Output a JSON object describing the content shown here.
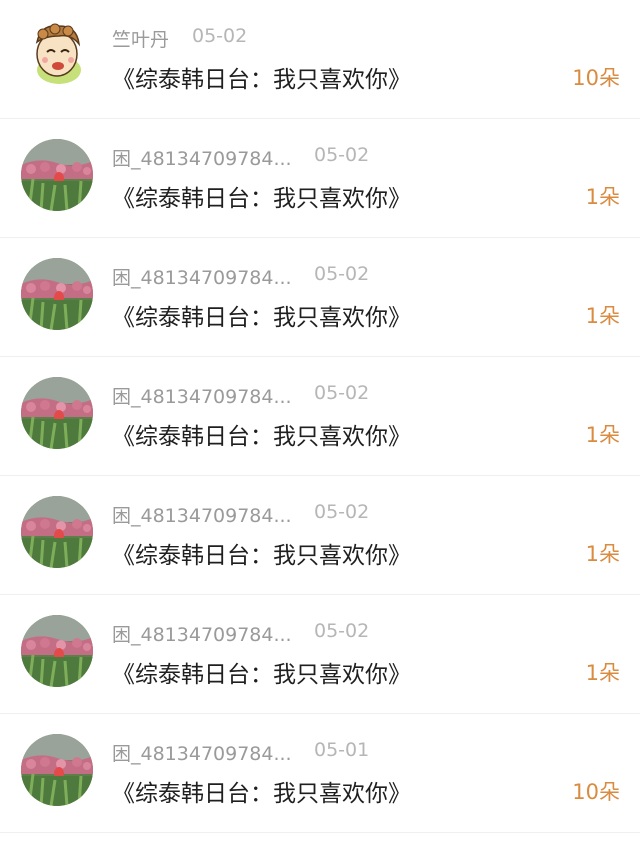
{
  "gifts": [
    {
      "name": "竺叶丹",
      "date": "05-02",
      "title": "《综泰韩日台：我只喜欢你》",
      "count": "10朵",
      "avatar": "cartoon-avatar"
    },
    {
      "name": "困_48134709784...",
      "date": "05-02",
      "title": "《综泰韩日台：我只喜欢你》",
      "count": "1朵",
      "avatar": "tulip-avatar"
    },
    {
      "name": "困_48134709784...",
      "date": "05-02",
      "title": "《综泰韩日台：我只喜欢你》",
      "count": "1朵",
      "avatar": "tulip-avatar"
    },
    {
      "name": "困_48134709784...",
      "date": "05-02",
      "title": "《综泰韩日台：我只喜欢你》",
      "count": "1朵",
      "avatar": "tulip-avatar"
    },
    {
      "name": "困_48134709784...",
      "date": "05-02",
      "title": "《综泰韩日台：我只喜欢你》",
      "count": "1朵",
      "avatar": "tulip-avatar"
    },
    {
      "name": "困_48134709784...",
      "date": "05-02",
      "title": "《综泰韩日台：我只喜欢你》",
      "count": "1朵",
      "avatar": "tulip-avatar"
    },
    {
      "name": "困_48134709784...",
      "date": "05-01",
      "title": "《综泰韩日台：我只喜欢你》",
      "count": "10朵",
      "avatar": "tulip-avatar"
    }
  ],
  "colors": {
    "accent": "#d98b3f",
    "name_text": "#9a9a9a",
    "date_text": "#b6b6b6",
    "title_text": "#1f1f1f",
    "divider": "#efefef"
  }
}
